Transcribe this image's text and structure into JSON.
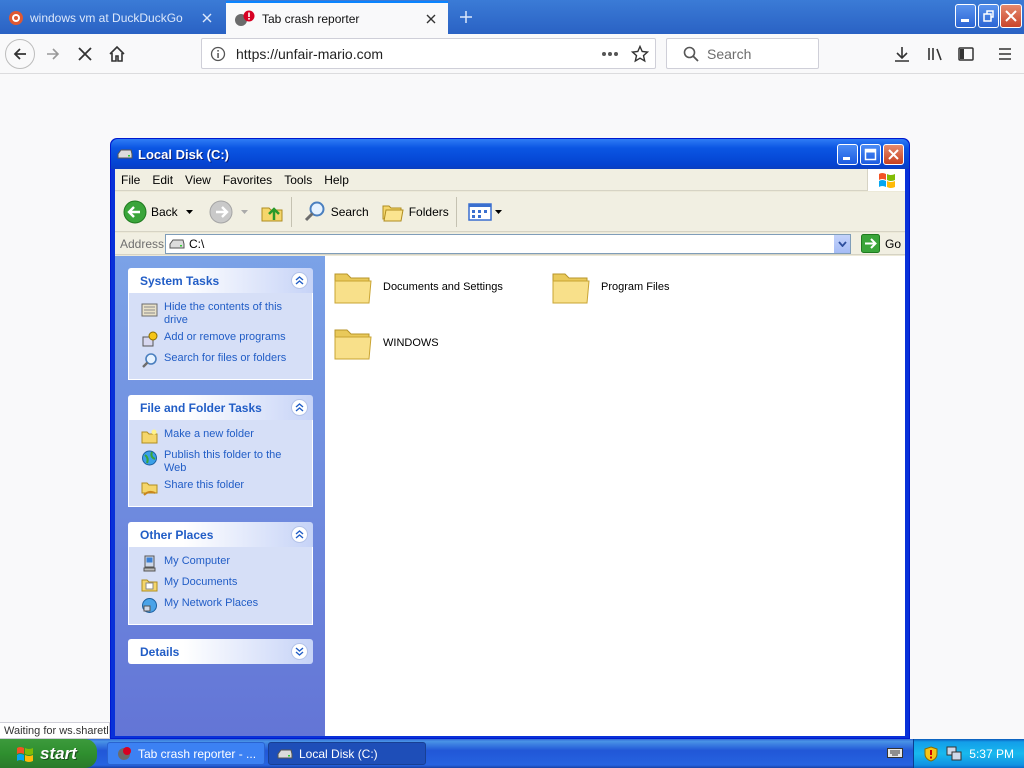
{
  "browser": {
    "tabs": [
      {
        "title": "windows vm at DuckDuckGo",
        "active": false
      },
      {
        "title": "Tab crash reporter",
        "active": true
      }
    ],
    "url": "https://unfair-mario.com",
    "search_placeholder": "Search",
    "status_text": "Waiting for ws.sharetl"
  },
  "window": {
    "title": "Local Disk (C:)",
    "menu": [
      "File",
      "Edit",
      "View",
      "Favorites",
      "Tools",
      "Help"
    ],
    "toolbar": {
      "back": "Back",
      "search": "Search",
      "folders": "Folders"
    },
    "address_label": "Address",
    "address_value": "C:\\",
    "go_label": "Go"
  },
  "tasks": {
    "system": {
      "title": "System Tasks",
      "items": [
        "Hide the contents of this drive",
        "Add or remove programs",
        "Search for files or folders"
      ]
    },
    "file_folder": {
      "title": "File and Folder Tasks",
      "items": [
        "Make a new folder",
        "Publish this folder to the Web",
        "Share this folder"
      ]
    },
    "other_places": {
      "title": "Other Places",
      "items": [
        "My Computer",
        "My Documents",
        "My Network Places"
      ]
    },
    "details": {
      "title": "Details"
    }
  },
  "folders": [
    "Documents and Settings",
    "Program Files",
    "WINDOWS"
  ],
  "taskbar": {
    "start_label": "start",
    "buttons": [
      "Tab crash reporter - ...",
      "Local Disk (C:)"
    ],
    "clock": "5:37 PM"
  },
  "colors": {
    "xp_blue": "#0831d9",
    "task_link": "#215dc6",
    "start_green": "#2f8f2f"
  }
}
